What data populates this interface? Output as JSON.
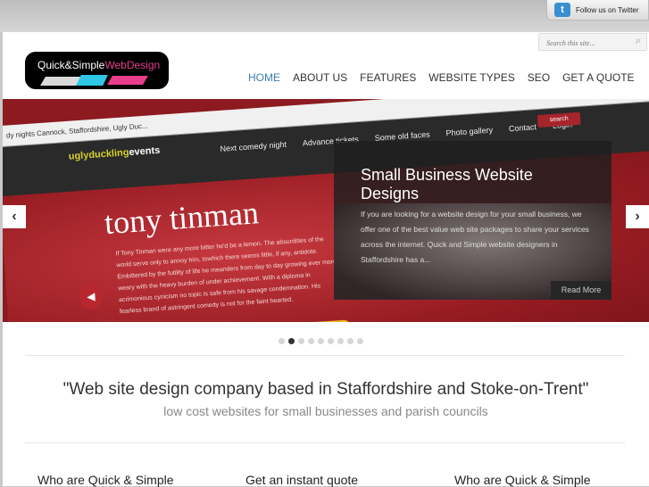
{
  "twitter": {
    "label": "Follow us on Twitter",
    "icon": "twitter-bird-icon"
  },
  "search": {
    "placeholder": "Search this site..."
  },
  "logo": {
    "part1": "Quick&Simple",
    "part2": "WebDesign"
  },
  "nav": {
    "items": [
      "HOME",
      "ABOUT US",
      "FEATURES",
      "WEBSITE TYPES",
      "SEO",
      "GET A QUOTE"
    ],
    "active": "HOME"
  },
  "slide": {
    "screenshot": {
      "url_text": "dy nights Cannock, Staffordshire, Ugly Duc...",
      "brand_a": "uglyduckling",
      "brand_b": "events",
      "nav": [
        "Next comedy night",
        "Advance tickets",
        "Some old faces",
        "Photo gallery",
        "Contact",
        "Login"
      ],
      "search_btn": "search",
      "name": "tony tinman",
      "bio": "If Tony Tinman were any more bitter he'd be a lemon. The absurdities of the world serve only to annoy him, towhich there seems little, if any, antidote. Embittered by the futility of life he meanders from day to day growing ever more weary with the heavy burden of under achievement. With a diploma in acrimonious cynicism no topic is safe from his savage condemnation. His fearless brand of astringent comedy is not for the faint hearted."
    },
    "caption": {
      "title": "Small Business Website Designs",
      "body": "If you are looking for a website design for your small business, we offer one of the best value web site packages to share your services across the internet. Quick and Simple website designers in Staffordshire has a...",
      "more": "Read More"
    },
    "prev_arrow": "‹",
    "next_arrow": "›",
    "dots_total": 9,
    "dots_active_index": 1
  },
  "tagline": {
    "headline": "\"Web site design company based in Staffordshire and Stoke-on-Trent\"",
    "sub": "low cost websites for small businesses and parish councils"
  },
  "columns": [
    "Who are Quick & Simple",
    "Get an instant quote",
    "Who are Quick & Simple"
  ],
  "colors": {
    "nav_active": "#3c7fb1",
    "slide_red": "#8c1a1f",
    "caption_bg": "#1e1e1e"
  }
}
